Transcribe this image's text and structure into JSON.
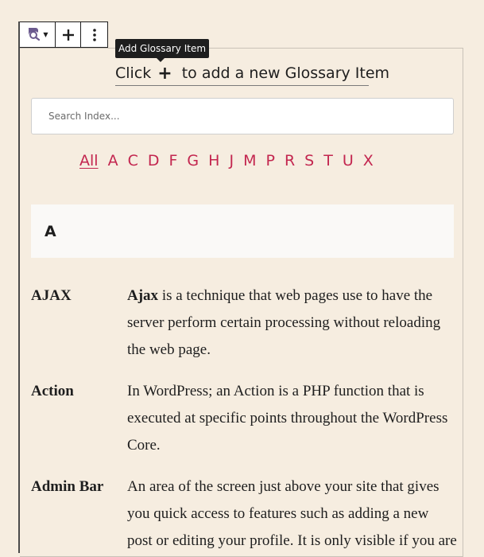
{
  "toolbar": {
    "tooltip": "Add Glossary Item"
  },
  "hint": {
    "before": "Click",
    "plus": "+",
    "after": "to add a new Glossary Item"
  },
  "search": {
    "placeholder": "Search Index..."
  },
  "letters": [
    "All",
    "A",
    "C",
    "D",
    "F",
    "G",
    "H",
    "J",
    "M",
    "P",
    "R",
    "S",
    "T",
    "U",
    "X"
  ],
  "section": {
    "letter": "A"
  },
  "entries": [
    {
      "term": "AJAX",
      "def_bold": "Ajax",
      "def": " is a technique that web pages use to have the server perform certain processing without reloading the web page."
    },
    {
      "term": "Action",
      "def_bold": "",
      "def": "In WordPress; an Action is a PHP function that is executed at specific points throughout the WordPress Core."
    },
    {
      "term": "Admin Bar",
      "def_bold": "",
      "def": "An area of the screen just above your site that gives you quick access to features such as adding a new post or editing your profile. It is only visible if you are"
    }
  ]
}
